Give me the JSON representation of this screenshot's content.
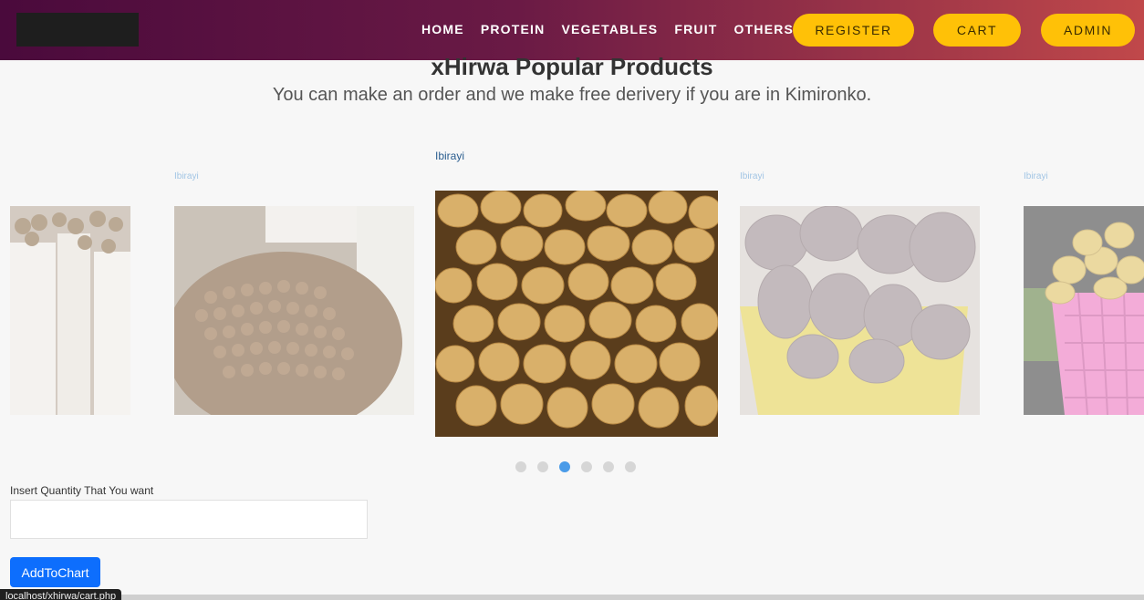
{
  "nav": {
    "home": "HOME",
    "protein": "PROTEIN",
    "vegetables": "VEGETABLES",
    "fruit": "FRUIT",
    "others": "OTHERS"
  },
  "buttons": {
    "register": "REGISTER",
    "cart": "CART",
    "admin": "ADMIN"
  },
  "heading": {
    "title": "xHirwa Popular Products",
    "subtitle": "You can make an order and we make free derivery if you are in Kimironko."
  },
  "carousel": {
    "slides": [
      {
        "caption": ""
      },
      {
        "caption": "Ibirayi"
      },
      {
        "caption": "Ibirayi"
      },
      {
        "caption": "Ibirayi"
      },
      {
        "caption": "Ibirayi"
      }
    ],
    "active_index": 3,
    "dot_count": 6
  },
  "form": {
    "qty_label": "Insert Quantity That You want",
    "qty_value": "",
    "submit_label": "AddToChart"
  },
  "status_bar": {
    "url": "localhost/xhirwa/cart.php"
  },
  "colors": {
    "accent": "#ffc107",
    "primary": "#0d6efd",
    "dot_active": "#4a9be8"
  }
}
